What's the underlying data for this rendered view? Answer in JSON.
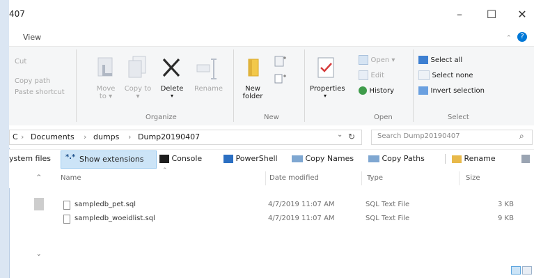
{
  "window": {
    "title_fragment": "407",
    "minimize": "–",
    "maximize": "☐",
    "close": "✕"
  },
  "menu_tab": "View",
  "ribbon": {
    "clipboard": {
      "cut": "Cut",
      "copy_path": "Copy path",
      "paste_shortcut": "Paste shortcut"
    },
    "organize": {
      "move_to": "Move to ▾",
      "copy_to": "Copy to ▾",
      "delete": "Delete",
      "delete_arrow": "▾",
      "rename": "Rename",
      "group": "Organize"
    },
    "new": {
      "new_folder": "New folder",
      "group": "New"
    },
    "open": {
      "properties": "Properties",
      "properties_arrow": "▾",
      "open": "Open ▾",
      "edit": "Edit",
      "history": "History",
      "group": "Open"
    },
    "select": {
      "select_all": "Select all",
      "select_none": "Select none",
      "invert": "Invert selection",
      "group": "Select"
    }
  },
  "address": {
    "crumbs": [
      "C",
      "Documents",
      "dumps",
      "Dump20190407"
    ],
    "sep": "›",
    "search_placeholder": "Search Dump20190407"
  },
  "toolbar": {
    "system_files": "ystem files",
    "show_extensions": "Show extensions",
    "console": "Console",
    "powershell": "PowerShell",
    "copy_names": "Copy Names",
    "copy_paths": "Copy Paths",
    "rename": "Rename"
  },
  "columns": {
    "name": "Name",
    "date": "Date modified",
    "type": "Type",
    "size": "Size"
  },
  "files": [
    {
      "name": "sampledb_pet.sql",
      "date": "4/7/2019 11:07 AM",
      "type": "SQL Text File",
      "size": "3 KB"
    },
    {
      "name": "sampledb_woeidlist.sql",
      "date": "4/7/2019 11:07 AM",
      "type": "SQL Text File",
      "size": "9 KB"
    }
  ],
  "colors": {
    "accent": "#0078d7",
    "sidebar": "#dbe6f3"
  }
}
